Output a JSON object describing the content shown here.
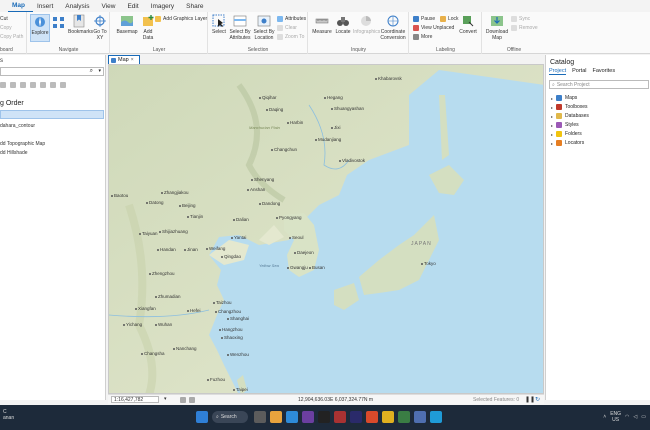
{
  "ribbon": {
    "tabs": [
      "Map",
      "Insert",
      "Analysis",
      "View",
      "Edit",
      "Imagery",
      "Share"
    ],
    "clipboard": {
      "cut": "Cut",
      "copy": "Copy",
      "copy_path": "Copy Path",
      "label": "board"
    },
    "navigate": {
      "explore": "Explore",
      "bookmarks": "Bookmarks",
      "goto": "Go To XY",
      "label": "Navigate"
    },
    "layer": {
      "basemap": "Basemap",
      "add_data": "Add Data",
      "add_graphics": "Add Graphics Layer",
      "label": "Layer"
    },
    "selection": {
      "select": "Select",
      "by_attr": "Select By Attributes",
      "by_loc": "Select By Location",
      "attributes": "Attributes",
      "clear": "Clear",
      "zoom_to": "Zoom To",
      "label": "Selection"
    },
    "inquiry": {
      "measure": "Measure",
      "locate": "Locate",
      "infographics": "Infographics",
      "coord_conv": "Coordinate Conversion",
      "label": "Inquiry"
    },
    "labeling": {
      "pause": "Pause",
      "lock": "Lock",
      "view_unplaced": "View Unplaced",
      "more": "More",
      "convert": "Convert",
      "label": "Labeling"
    },
    "offline": {
      "download": "Download Map",
      "sync": "Sync",
      "remove": "Remove",
      "label": "Offline"
    }
  },
  "left_pane": {
    "title": "s",
    "drawing_order": "g Order",
    "layers": [
      "dahara_contour",
      "dd Topographic Map",
      "dd Hillshade"
    ]
  },
  "map": {
    "tab_label": "Map",
    "scale": "1:16,427,782",
    "coordinates": "12,904,636.03E 6,037,324.77N m",
    "selected_features": "Selected Features: 0",
    "cities": [
      {
        "name": "Khabarovsk"
      },
      {
        "name": "Qiqihar"
      },
      {
        "name": "Hegang"
      },
      {
        "name": "Daqing"
      },
      {
        "name": "Shuangyashan"
      },
      {
        "name": "Harbin"
      },
      {
        "name": "Jixi"
      },
      {
        "name": "Mudanjiang"
      },
      {
        "name": "Changchun"
      },
      {
        "name": "Vladivostok"
      },
      {
        "name": "Shenyang"
      },
      {
        "name": "Anshan"
      },
      {
        "name": "Zhangjiakou"
      },
      {
        "name": "Beijing"
      },
      {
        "name": "Dandong"
      },
      {
        "name": "Tianjin"
      },
      {
        "name": "Pyongyang"
      },
      {
        "name": "Datong"
      },
      {
        "name": "Dalian"
      },
      {
        "name": "Taiyuan"
      },
      {
        "name": "Shijiazhuang"
      },
      {
        "name": "Yantai"
      },
      {
        "name": "Seoul"
      },
      {
        "name": "Handan"
      },
      {
        "name": "Jinan"
      },
      {
        "name": "Weifang"
      },
      {
        "name": "Daejeon"
      },
      {
        "name": "Qingdao"
      },
      {
        "name": "Zhengzhou"
      },
      {
        "name": "Gwangju"
      },
      {
        "name": "Busan"
      },
      {
        "name": "Tokyo"
      },
      {
        "name": "Zhumadian"
      },
      {
        "name": "Taizhou"
      },
      {
        "name": "Xiangfan"
      },
      {
        "name": "Hefei"
      },
      {
        "name": "Changzhou"
      },
      {
        "name": "Shanghai"
      },
      {
        "name": "Yichang"
      },
      {
        "name": "Wuhan"
      },
      {
        "name": "Hangzhou"
      },
      {
        "name": "Shaoxing"
      },
      {
        "name": "Changsha"
      },
      {
        "name": "Nanchang"
      },
      {
        "name": "Wenzhou"
      },
      {
        "name": "Fuzhou"
      },
      {
        "name": "Taipei"
      },
      {
        "name": "Baotou"
      }
    ],
    "seas": {
      "yellow_sea": "Yellow Sea",
      "manchurian": "Manchurian Plain"
    },
    "countries": {
      "japan": "JAPAN"
    }
  },
  "right_pane": {
    "title": "Catalog",
    "tabs": [
      "Project",
      "Portal",
      "Favorites"
    ],
    "search_placeholder": "Search Project",
    "items": [
      "Maps",
      "Toolboxes",
      "Databases",
      "Styles",
      "Folders",
      "Locators"
    ]
  },
  "taskbar": {
    "weather_temp": "C",
    "weather_desc": "anan",
    "search": "Search",
    "lang": "ENG",
    "region": "US"
  }
}
